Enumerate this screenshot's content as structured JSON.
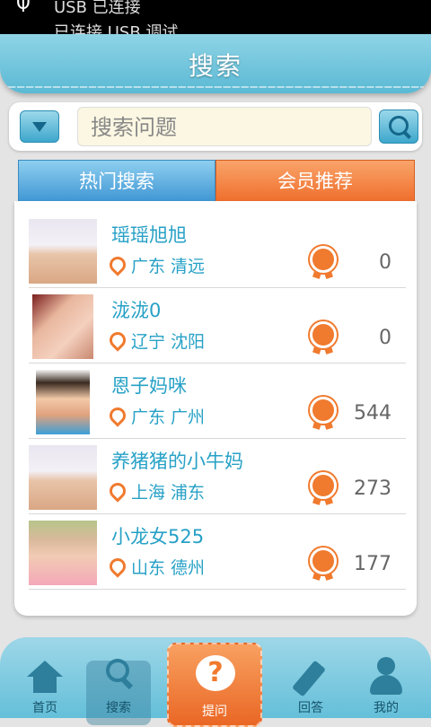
{
  "status_bar": {
    "usb_icon": "usb-icon",
    "line1": "USB 已连接",
    "line2": "已连接 USB 调试"
  },
  "header": {
    "title": "搜索"
  },
  "search": {
    "placeholder": "搜索问题",
    "dropdown_icon": "triangle-down-icon",
    "search_icon": "search-icon"
  },
  "tabs": [
    {
      "label": "热门搜索"
    },
    {
      "label": "会员推荐"
    }
  ],
  "members": [
    {
      "name": "瑶瑶旭旭",
      "location": "广东 清远",
      "count": "0"
    },
    {
      "name": "泷泷0",
      "location": "辽宁 沈阳",
      "count": "0"
    },
    {
      "name": "恩子妈咪",
      "location": "广东 广州",
      "count": "544"
    },
    {
      "name": "养猪猪的小牛妈",
      "location": "上海 浦东",
      "count": "273"
    },
    {
      "name": "小龙女525",
      "location": "山东 德州",
      "count": "177"
    }
  ],
  "bottom_nav": [
    {
      "label": "首页",
      "icon": "home-icon"
    },
    {
      "label": "搜索",
      "icon": "search-icon"
    },
    {
      "label": "提问",
      "icon": "question-bubble-icon"
    },
    {
      "label": "回答",
      "icon": "pencil-icon"
    },
    {
      "label": "我的",
      "icon": "user-icon"
    }
  ],
  "colors": {
    "accent_blue": "#5ab9d4",
    "accent_orange": "#ef6e2c",
    "name_text": "#27a1c6"
  }
}
